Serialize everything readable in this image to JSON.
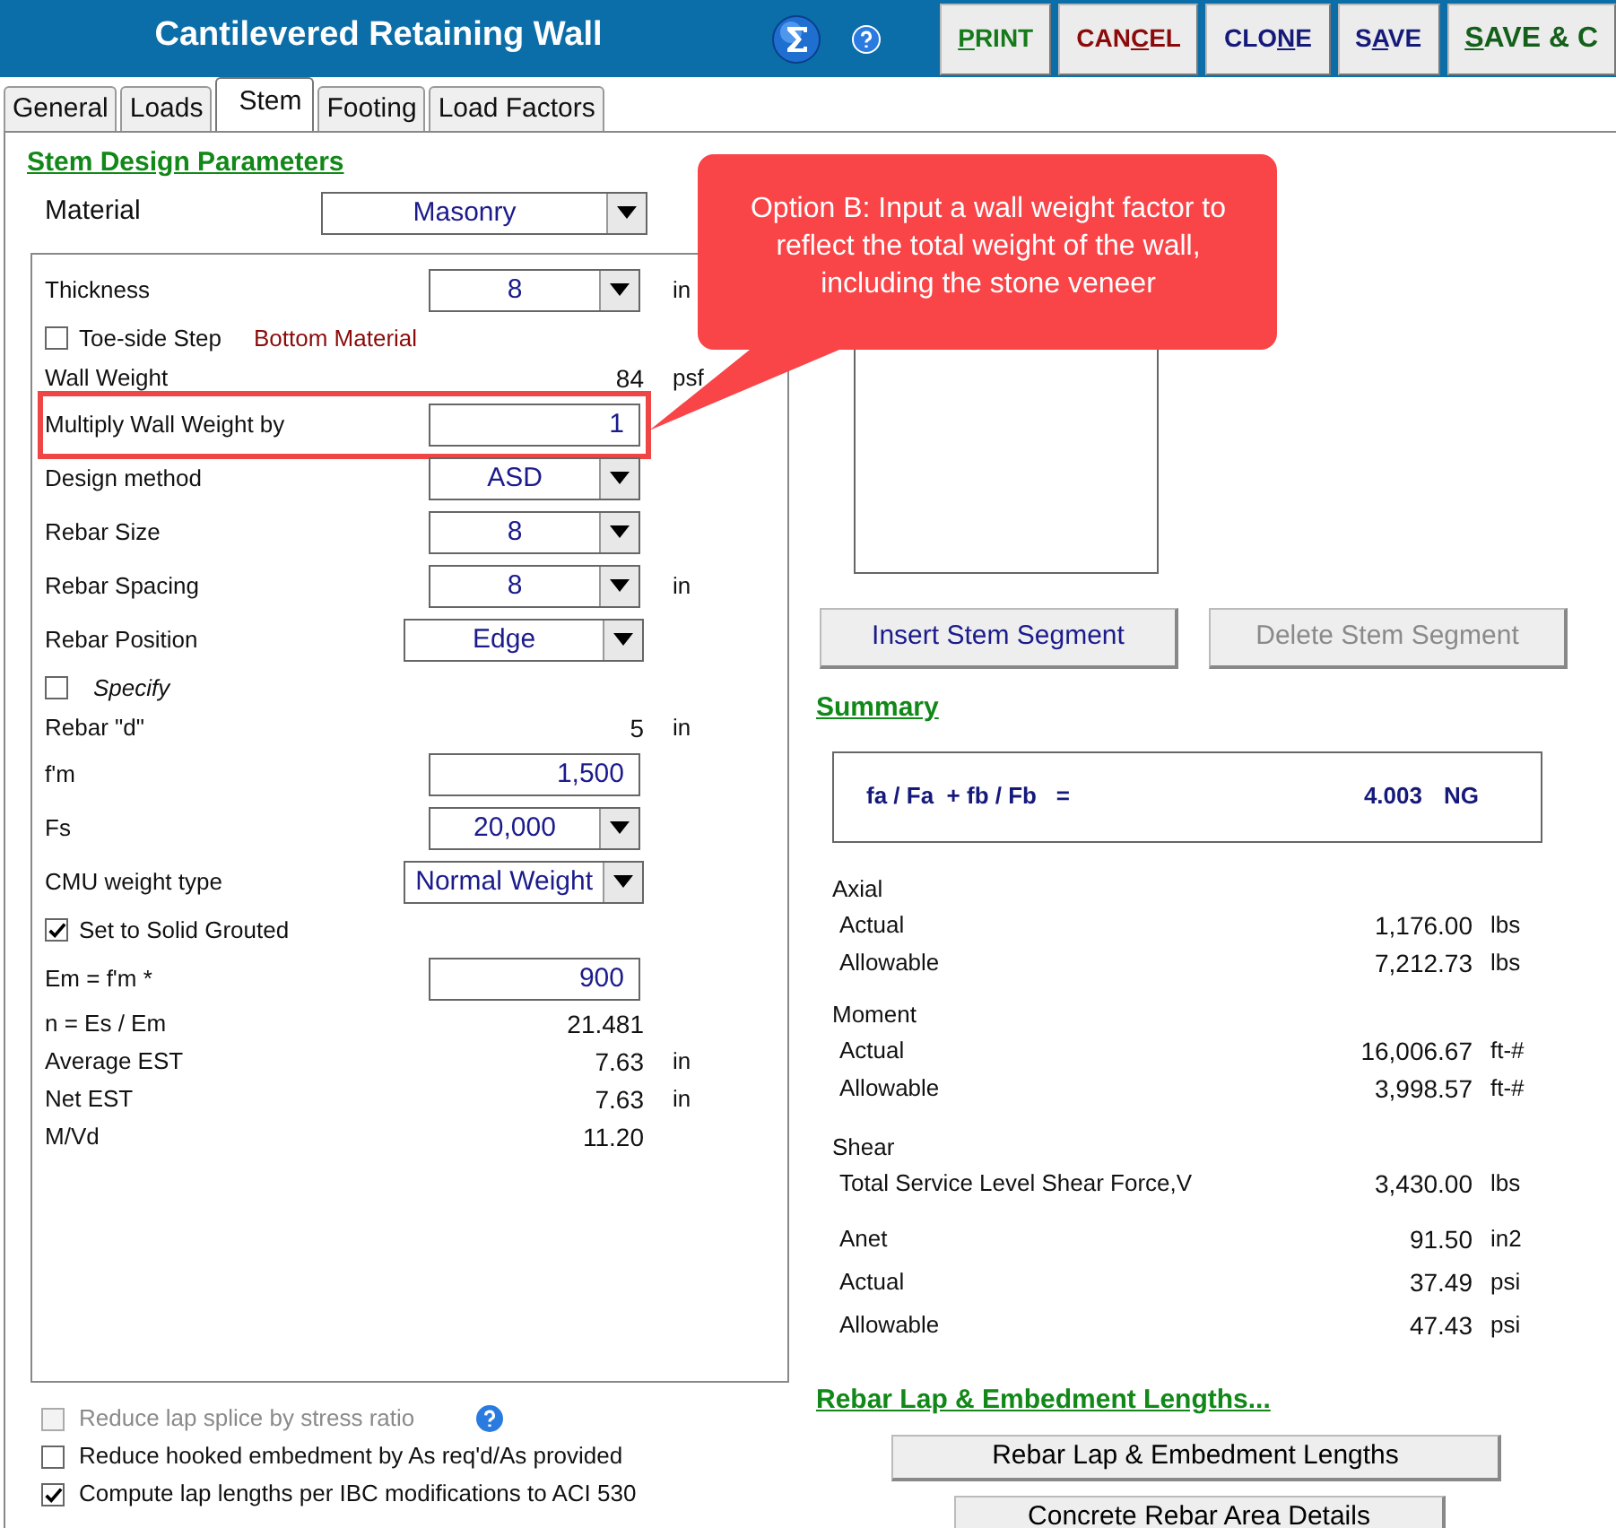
{
  "window": {
    "title": "Cantilevered Retaining Wall"
  },
  "toolbar": {
    "buttons": [
      {
        "kind": "print",
        "key": "P",
        "after": "RINT"
      },
      {
        "kind": "cancel",
        "before": "CAN",
        "key": "C",
        "after": "EL"
      },
      {
        "kind": "clone",
        "before": "CLO",
        "key": "N",
        "after": "E"
      },
      {
        "kind": "save",
        "before": "S",
        "key": "A",
        "after": "VE"
      },
      {
        "kind": "save_close",
        "key": "S",
        "after": "AVE & C"
      }
    ]
  },
  "tabs": [
    {
      "label": "General",
      "selected": false
    },
    {
      "label": "Loads",
      "selected": false
    },
    {
      "label": "Stem",
      "selected": true
    },
    {
      "label": "Footing",
      "selected": false
    },
    {
      "label": "Load Factors",
      "selected": false
    }
  ],
  "stem_design": {
    "heading": "Stem Design Parameters",
    "material": {
      "label": "Material",
      "value": "Masonry"
    },
    "fields": [
      {
        "kind": "select",
        "label": "Thickness",
        "value": "8",
        "unit": "in",
        "wide": false,
        "highlighted": false
      },
      {
        "kind": "checkbox",
        "label": "Toe-side Step",
        "checked": false,
        "italic": false,
        "note": "Bottom Material",
        "highlighted": false
      },
      {
        "kind": "readout",
        "label": "Wall Weight",
        "value": "84",
        "unit": "psf",
        "highlighted": false
      },
      {
        "kind": "input",
        "label": "Multiply Wall Weight by",
        "value": "1",
        "highlighted": true
      },
      {
        "kind": "select",
        "label": "Design method",
        "value": "ASD",
        "wide": false,
        "highlighted": false
      },
      {
        "kind": "select",
        "label": "Rebar Size",
        "value": "8",
        "wide": false,
        "highlighted": false
      },
      {
        "kind": "select",
        "label": "Rebar Spacing",
        "value": "8",
        "unit": "in",
        "wide": false,
        "highlighted": false
      },
      {
        "kind": "select",
        "label": "Rebar Position",
        "value": "Edge",
        "wide": true,
        "highlighted": false
      },
      {
        "kind": "checkbox",
        "label": "Specify",
        "checked": false,
        "italic": true,
        "highlighted": false
      },
      {
        "kind": "readout",
        "label": "Rebar \"d\"",
        "value": "5",
        "unit": "in",
        "highlighted": false
      },
      {
        "kind": "input",
        "label": "f'm",
        "value": "1,500",
        "highlighted": false
      },
      {
        "kind": "select",
        "label": "Fs",
        "value": "20,000",
        "wide": false,
        "highlighted": false
      },
      {
        "kind": "select",
        "label": "CMU weight type",
        "value": "Normal Weight",
        "wide": true,
        "highlighted": false
      },
      {
        "kind": "checkbox",
        "label": "Set to Solid Grouted",
        "checked": true,
        "italic": false,
        "highlighted": false
      },
      {
        "kind": "input",
        "label": "Em = f'm *",
        "value": "900",
        "highlighted": false
      },
      {
        "kind": "readout",
        "label": "n = Es / Em",
        "value": "21.481",
        "highlighted": false
      },
      {
        "kind": "readout",
        "label": "Average EST",
        "value": "7.63",
        "unit": "in",
        "highlighted": false
      },
      {
        "kind": "readout",
        "label": "Net EST",
        "value": "7.63",
        "unit": "in",
        "highlighted": false
      },
      {
        "kind": "readout",
        "label": "M/Vd",
        "value": "11.20",
        "highlighted": false
      }
    ]
  },
  "options": [
    {
      "label": "Reduce lap splice by stress ratio",
      "checked": false,
      "disabled": true,
      "help": true
    },
    {
      "label": "Reduce hooked embedment by As req'd/As provided",
      "checked": false,
      "disabled": false,
      "help": false
    },
    {
      "label": "Compute lap lengths per IBC modifications to ACI 530",
      "checked": true,
      "disabled": false,
      "help": false
    }
  ],
  "segment_buttons": [
    {
      "label": "Insert Stem Segment",
      "disabled": false
    },
    {
      "label": "Delete Stem Segment",
      "disabled": true
    }
  ],
  "summary": {
    "heading": "Summary",
    "interaction": {
      "formula": "fa / Fa  + fb / Fb   =",
      "value": "4.003",
      "status": "NG"
    },
    "sections": [
      {
        "title": "Axial",
        "rows": [
          {
            "label": "Actual",
            "value": "1,176.00",
            "unit": "lbs"
          },
          {
            "label": "Allowable",
            "value": "7,212.73",
            "unit": "lbs"
          }
        ]
      },
      {
        "title": "Moment",
        "rows": [
          {
            "label": "Actual",
            "value": "16,006.67",
            "unit": "ft-#"
          },
          {
            "label": "Allowable",
            "value": "3,998.57",
            "unit": "ft-#"
          }
        ]
      },
      {
        "title": "Shear",
        "rows": [
          {
            "label": "Total Service Level Shear Force,V",
            "value": "3,430.00",
            "unit": "lbs"
          },
          {
            "label": "Anet",
            "value": "91.50",
            "unit": "in2"
          },
          {
            "label": "Actual",
            "value": "37.49",
            "unit": "psi"
          },
          {
            "label": "Allowable",
            "value": "47.43",
            "unit": "psi"
          }
        ]
      }
    ]
  },
  "rebar_lap": {
    "heading": "Rebar Lap & Embedment Lengths...",
    "buttons": [
      "Rebar Lap & Embedment Lengths",
      "Concrete Rebar Area Details"
    ]
  },
  "callout": {
    "text": "Option B: Input a wall weight factor to reflect the total weight of the wall, including the stone veneer"
  }
}
